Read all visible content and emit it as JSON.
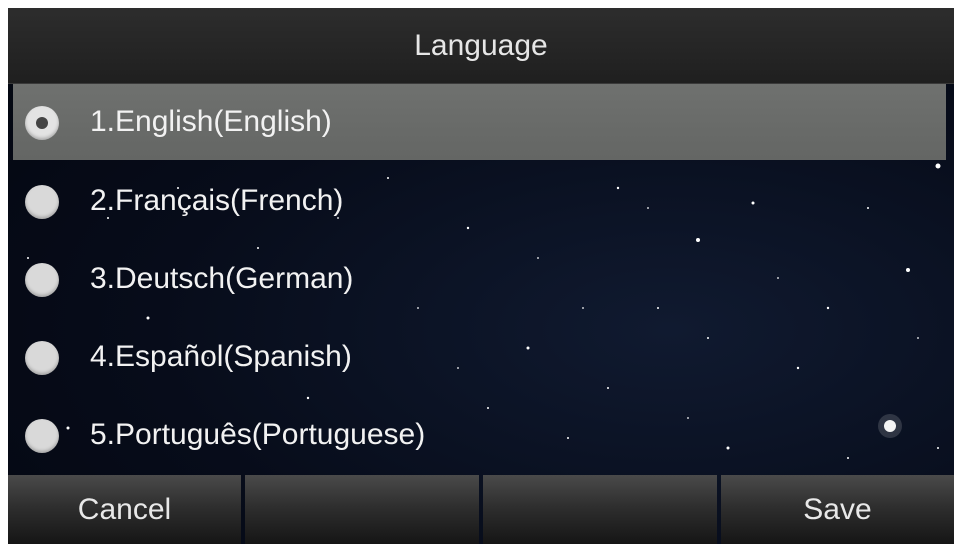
{
  "header": {
    "title": "Language"
  },
  "languages": [
    {
      "label": "1.English(English)",
      "selected": true
    },
    {
      "label": "2.Français(French)",
      "selected": false
    },
    {
      "label": "3.Deutsch(German)",
      "selected": false
    },
    {
      "label": "4.Español(Spanish)",
      "selected": false
    },
    {
      "label": "5.Português(Portuguese)",
      "selected": false
    }
  ],
  "softkeys": {
    "key1": "Cancel",
    "key2": "",
    "key3": "",
    "key4": "Save"
  },
  "colors": {
    "highlight": "#6a6c6a",
    "background": "#070c1a",
    "text": "#f2f2f2"
  }
}
